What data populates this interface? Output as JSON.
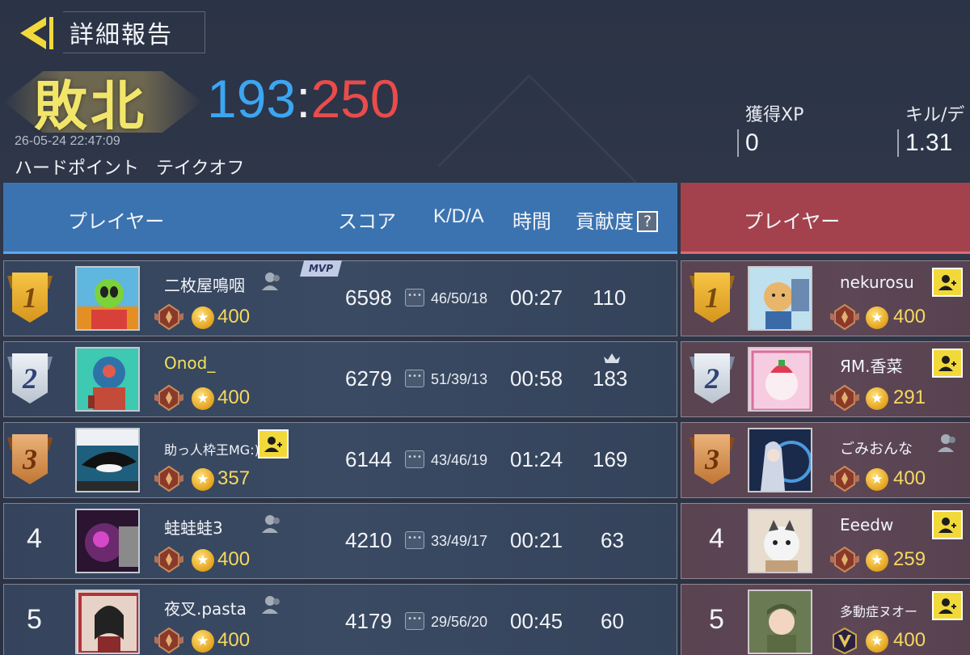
{
  "header": {
    "title": "詳細報告",
    "result": "敗北",
    "score_blue": "193",
    "score_sep": ":",
    "score_red": "250",
    "timestamp": "26-05-24 22:47:09",
    "mode": "ハードポイント テイクオフ"
  },
  "stats": {
    "xp_label": "獲得XP",
    "xp_value": "0",
    "kd_label": "キル/デ",
    "kd_value": "1.31"
  },
  "columns": {
    "player": "プレイヤー",
    "score": "スコア",
    "kda": "K/D/A",
    "time": "時間",
    "contribution": "貢献度",
    "help": "?"
  },
  "right_columns": {
    "player": "プレイヤー"
  },
  "mvp_label": "MVP",
  "colors": {
    "blue_team": "#3b73b0",
    "red_team": "#a3424d",
    "score_blue": "#3ba6f2",
    "score_red": "#ea4b4b",
    "result": "#f2e66a",
    "level": "#f6d860"
  },
  "team_blue": [
    {
      "rank": "1",
      "name": "二枚屋鳴咽",
      "level": "400",
      "score": "6598",
      "kda": "46/50/18",
      "time": "00:27",
      "contribution": "110"
    },
    {
      "rank": "2",
      "name": "Onod_",
      "level": "400",
      "score": "6279",
      "kda": "51/39/13",
      "time": "00:58",
      "contribution": "183"
    },
    {
      "rank": "3",
      "name": "助っ人枠王MG:)",
      "level": "357",
      "score": "6144",
      "kda": "43/46/19",
      "time": "01:24",
      "contribution": "169"
    },
    {
      "rank": "4",
      "name": "蛙蛙蛙3",
      "level": "400",
      "score": "4210",
      "kda": "33/49/17",
      "time": "00:21",
      "contribution": "63"
    },
    {
      "rank": "5",
      "name": "夜叉.pasta",
      "level": "400",
      "score": "4179",
      "kda": "29/56/20",
      "time": "00:45",
      "contribution": "60"
    }
  ],
  "team_red": [
    {
      "rank": "1",
      "name": "nekurosu",
      "level": "400"
    },
    {
      "rank": "2",
      "name": "ЯM.香菜",
      "level": "291"
    },
    {
      "rank": "3",
      "name": "ごみおんな",
      "level": "400"
    },
    {
      "rank": "4",
      "name": "Eeedw",
      "level": "259"
    },
    {
      "rank": "5",
      "name": "多動症ヌオー",
      "level": "400"
    }
  ]
}
